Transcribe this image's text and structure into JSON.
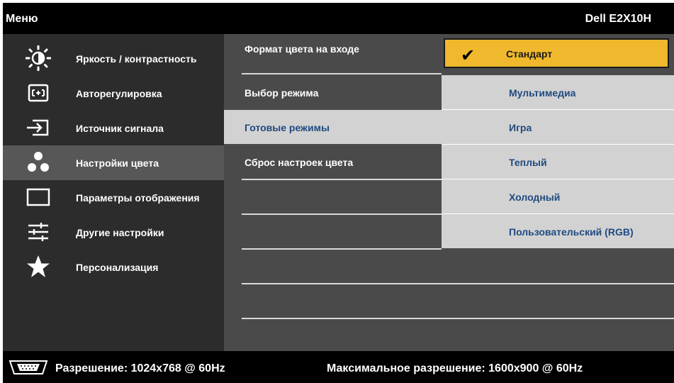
{
  "header": {
    "menu_title": "Меню",
    "model": "Dell E2X10H"
  },
  "sidebar": {
    "items": [
      {
        "label": "Яркость / контрастность",
        "icon": "brightness-icon",
        "active": false
      },
      {
        "label": "Авторегулировка",
        "icon": "auto-adjust-icon",
        "active": false
      },
      {
        "label": "Источник сигнала",
        "icon": "input-source-icon",
        "active": false
      },
      {
        "label": "Настройки цвета",
        "icon": "color-settings-icon",
        "active": true
      },
      {
        "label": "Параметры отображения",
        "icon": "display-settings-icon",
        "active": false
      },
      {
        "label": "Другие настройки",
        "icon": "other-settings-icon",
        "active": false
      },
      {
        "label": "Персонализация",
        "icon": "star-icon",
        "active": false
      }
    ]
  },
  "color_menu": {
    "items": [
      {
        "label": "Формат цвета на входе"
      },
      {
        "label": "Выбор режима"
      },
      {
        "label": "Готовые режимы"
      },
      {
        "label": "Сброс настроек цвета"
      }
    ]
  },
  "preset_modes": {
    "selected": "Стандарт",
    "options": [
      {
        "label": "Мультимедиа"
      },
      {
        "label": "Игра"
      },
      {
        "label": "Теплый"
      },
      {
        "label": "Холодный"
      },
      {
        "label": "Пользовательский (RGB)"
      }
    ]
  },
  "status": {
    "resolution": "Разрешение: 1024x768 @ 60Hz",
    "max_resolution": "Максимальное разрешение: 1600x900 @ 60Hz",
    "connector_icon": "vga-connector-icon"
  },
  "colors": {
    "background": "#000000",
    "sidebar": "#2c2c2c",
    "active_item": "#575757",
    "panel": "#4a4a4a",
    "highlight_row": "#d2d2d2",
    "selected_option": "#f0b82c",
    "option_text": "#1f4a80"
  }
}
